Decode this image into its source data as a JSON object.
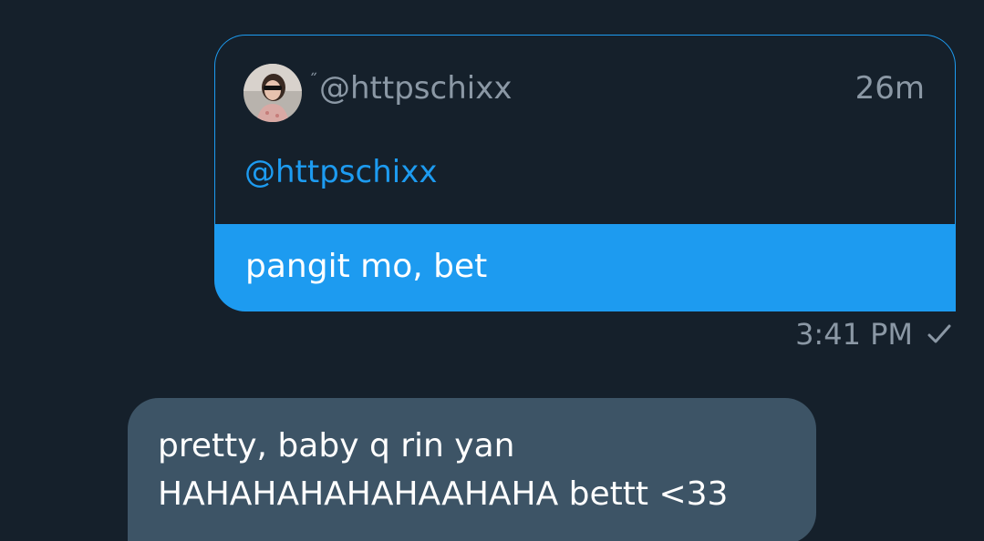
{
  "quoted_tweet": {
    "prefix_mark": "˝",
    "handle": "@httpschixx",
    "time": "26m",
    "body_mention": "@httpschixx"
  },
  "sent_message": {
    "text": "pangit mo, bet",
    "timestamp": "3:41 PM",
    "status_icon": "check-icon"
  },
  "received_message": {
    "line1": "pretty, baby q rin yan",
    "line2": "HAHAHAHAHAHAAHAHA bettt <33"
  },
  "colors": {
    "background": "#15202b",
    "accent": "#1d9bf0",
    "received_bubble": "#3d5466",
    "muted_text": "#8b98a5"
  }
}
